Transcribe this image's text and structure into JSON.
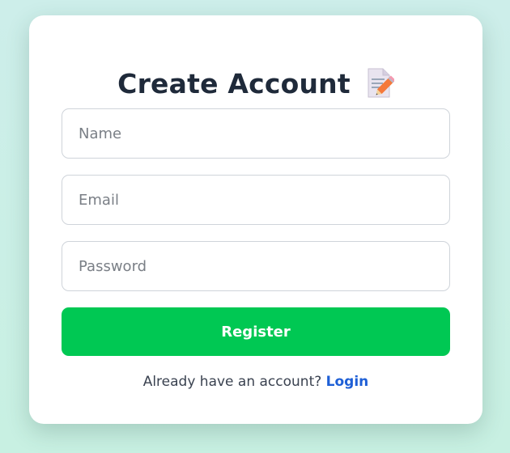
{
  "form": {
    "title": "Create Account",
    "title_icon": "memo-icon",
    "name_placeholder": "Name",
    "email_placeholder": "Email",
    "password_placeholder": "Password",
    "submit_label": "Register"
  },
  "footer": {
    "prompt": "Already have an account?",
    "link_label": "Login"
  },
  "colors": {
    "accent": "#00c853",
    "link": "#1e5fd6",
    "title": "#1f2a3a"
  }
}
